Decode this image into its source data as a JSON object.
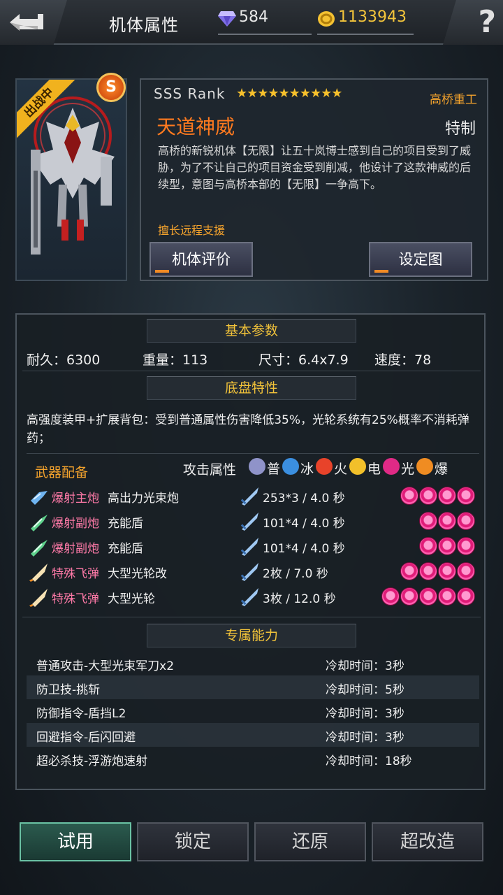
{
  "header": {
    "title": "机体属性",
    "gems": "584",
    "gold": "1133943",
    "help": "?"
  },
  "unit": {
    "deploy_tag": "出战中",
    "rank_badge": "S",
    "rank": "SSS Rank",
    "stars": "★★★★★★★★★★",
    "maker": "高桥重工",
    "name": "天道神威",
    "type": "特制",
    "description": "高桥的新锐机体【无限】让五十岚博士感到自己的项目受到了威胁，为了不让自己的项目资金受到削减，他设计了这款神威的后续型，意图与高桥本部的【无限】一争高下。",
    "specialty": "擅长远程支援",
    "eval_button": "机体评价",
    "setting_button": "设定图"
  },
  "basic": {
    "title": "基本参数",
    "durability": "耐久：6300",
    "weight": "重量：113",
    "size": "尺寸：6.4x7.9",
    "speed": "速度：78"
  },
  "chassis": {
    "title": "底盘特性",
    "text": "高强度装甲+扩展背包：受到普通属性伤害降低35%，光轮系统有25%概率不消耗弹药；"
  },
  "weapons": {
    "title": "武器配备",
    "attr_label": "攻击属性",
    "elements": [
      {
        "label": "普",
        "color": "#8f93c9"
      },
      {
        "label": "冰",
        "color": "#3b8fe0"
      },
      {
        "label": "火",
        "color": "#e8432a"
      },
      {
        "label": "电",
        "color": "#f2c02a"
      },
      {
        "label": "光",
        "color": "#e02a86"
      },
      {
        "label": "爆",
        "color": "#f08c22"
      }
    ],
    "rows": [
      {
        "category": "爆射主炮",
        "name": "高出力光束炮",
        "damage": "253*3 / 4.0 秒",
        "slots": 4,
        "icon": "beam-cannon-icon"
      },
      {
        "category": "爆射副炮",
        "name": "充能盾",
        "damage": "101*4 / 4.0 秒",
        "slots": 3,
        "icon": "green-cannon-icon"
      },
      {
        "category": "爆射副炮",
        "name": "充能盾",
        "damage": "101*4 / 4.0 秒",
        "slots": 3,
        "icon": "green-cannon-icon"
      },
      {
        "category": "特殊飞弹",
        "name": "大型光轮改",
        "damage": "2枚 / 7.0 秒",
        "slots": 4,
        "icon": "missile-icon"
      },
      {
        "category": "特殊飞弹",
        "name": "大型光轮",
        "damage": "3枚 / 12.0 秒",
        "slots": 5,
        "icon": "missile-icon"
      }
    ]
  },
  "skills": {
    "title": "专属能力",
    "rows": [
      {
        "name": "普通攻击-大型光束军刀x2",
        "cooldown": "冷却时间：3秒"
      },
      {
        "name": "防卫技-挑斩",
        "cooldown": "冷却时间：5秒"
      },
      {
        "name": "防御指令-盾挡L2",
        "cooldown": "冷却时间：3秒"
      },
      {
        "name": "回避指令-后闪回避",
        "cooldown": "冷却时间：3秒"
      },
      {
        "name": "超必杀技-浮游炮速射",
        "cooldown": "冷却时间：18秒"
      }
    ]
  },
  "footer": {
    "try": "试用",
    "lock": "锁定",
    "restore": "还原",
    "remodel": "超改造"
  }
}
